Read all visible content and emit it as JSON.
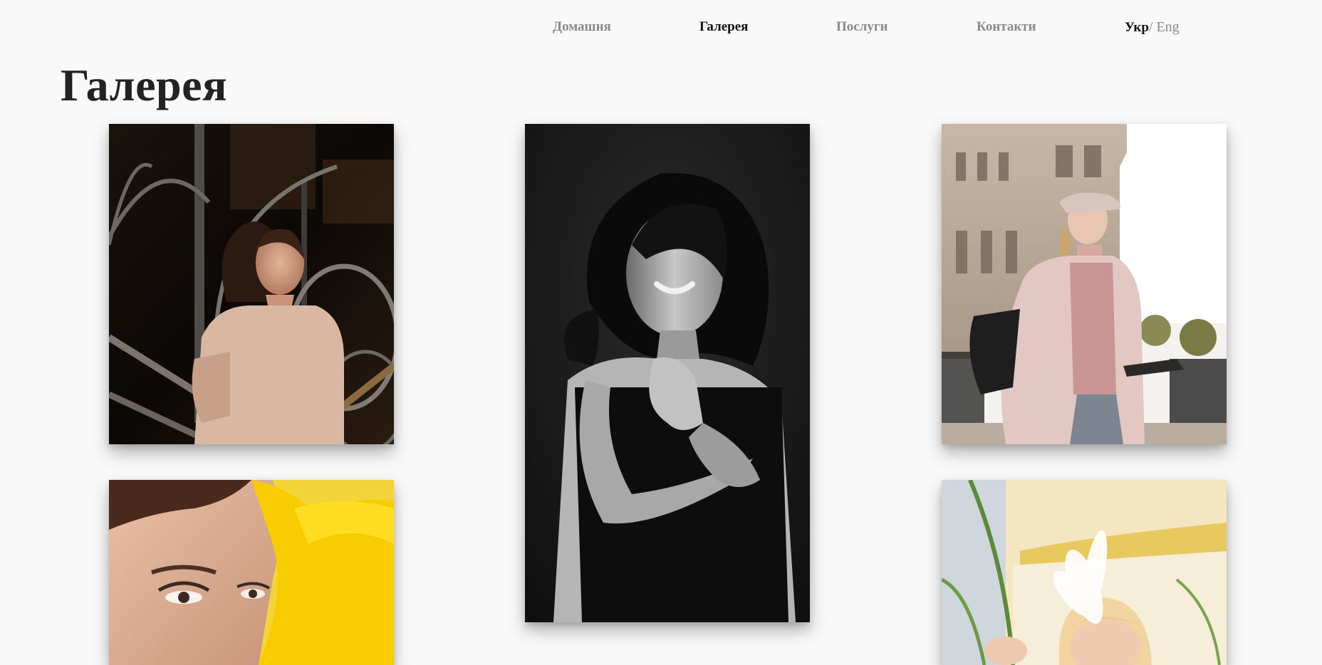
{
  "nav": {
    "items": [
      {
        "label": "Домашня",
        "active": false
      },
      {
        "label": "Галерея",
        "active": true
      },
      {
        "label": "Послуги",
        "active": false
      },
      {
        "label": "Контакти",
        "active": false
      }
    ],
    "lang": {
      "ukr": "Укр",
      "sep": "/ ",
      "eng": "Eng"
    }
  },
  "page": {
    "title": "Галерея"
  },
  "colors": {
    "background": "#f9f9f9",
    "nav_inactive": "#8a8a8a",
    "nav_active": "#111111",
    "title": "#222222"
  }
}
